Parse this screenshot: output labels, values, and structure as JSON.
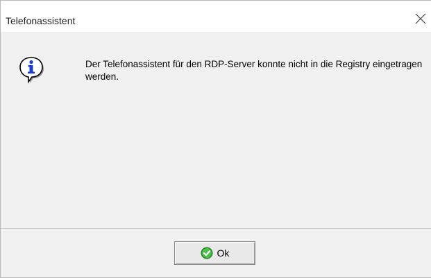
{
  "window": {
    "title": "Telefonassistent"
  },
  "dialog": {
    "icon": "info-icon",
    "message": "Der Telefonassistent für den RDP-Server konnte nicht in die Registry eingetragen werden."
  },
  "buttons": {
    "ok_label": "Ok",
    "ok_icon": "green-check-icon"
  },
  "colors": {
    "titlebar_bg": "#ffffff",
    "body_bg": "#f0f0f0",
    "info_blue": "#1c3fbf",
    "check_green": "#3aa63a"
  }
}
